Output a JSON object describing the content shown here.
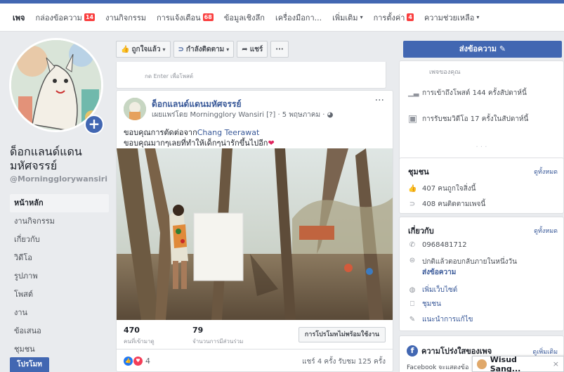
{
  "tabs": [
    {
      "label": "เพจ",
      "active": true
    },
    {
      "label": "กล่องข้อความ",
      "badge": "14"
    },
    {
      "label": "งานกิจกรรม"
    },
    {
      "label": "การแจ้งเตือน",
      "badge": "68"
    },
    {
      "label": "ข้อมูลเชิงลึก"
    },
    {
      "label": "เครื่องมือกา..."
    },
    {
      "label": "เพิ่มเติม",
      "caret": "▾"
    },
    {
      "label": "การตั้งค่า",
      "badge": "4"
    },
    {
      "label": "ความช่วยเหลือ",
      "caret": "▾"
    }
  ],
  "page": {
    "name": "ด็อกแลนด์แดนมหัศจรรย์",
    "handle": "@Morningglorywansiri",
    "nav": [
      "หน้าหลัก",
      "งานกิจกรรม",
      "เกี่ยวกับ",
      "วิดีโอ",
      "รูปภาพ",
      "โพสต์",
      "งาน",
      "ข้อเสนอ",
      "ชุมชน"
    ],
    "promote": "โปรโมท"
  },
  "actions": {
    "liked": "ถูกใจแล้ว",
    "following": "กำลังติดตาม",
    "share": "แชร์",
    "more": "···"
  },
  "composer": {
    "hint": "กด Enter เพื่อโพสต์"
  },
  "post": {
    "author": "ด็อกแลนด์แดนมหัศจรรย์",
    "meta": "เผยแพร่โดย Morningglory Wansiri [?] · 5 พฤษภาคม · ",
    "text1_prefix": "ขอบคุณการตัดต่อจาก",
    "text1_link": "Chang Teerawat",
    "text2": "ขอบคุณมากๆเลยที่ทำให้เด็กๆน่ารักขึ้นไปอีก",
    "reach": "470",
    "reach_label": "คนที่เข้ามาดู",
    "engagement": "79",
    "engagement_label": "จำนวนการมีส่วนร่วม",
    "boost": "การโปรโมทไม่พร้อมใช้งาน",
    "reactions_count": "4",
    "shares_text": "แชร์ 4 ครั้ง รับชม 125 ครั้ง"
  },
  "sidebar": {
    "send_message": "ส่งข้อความ",
    "top_text": "เพจของคุณ",
    "reach_week": "การเข้าถึงโพสต์ 144 ครั้งสัปดาห์นี้",
    "video_views": "การรับชมวิดีโอ 17 ครั้งในสัปดาห์นี้",
    "dots": "· · ·",
    "community": {
      "title": "ชุมชน",
      "see_all": "ดูทั้งหมด",
      "likes": "407 คนถูกใจสิ่งนี้",
      "follows": "408 คนติดตามเพจนี้"
    },
    "about": {
      "title": "เกี่ยวกับ",
      "see_all": "ดูทั้งหมด",
      "phone": "0968481712",
      "response": "ปกติแล้วตอบกลับภายในหนึ่งวัน",
      "send": "ส่งข้อความ",
      "website": "เพิ่มเว็บไซต์",
      "category": "ชุมชน",
      "suggest": "แนะนำการแก้ไข"
    },
    "transparency": {
      "title": "ความโปร่งใสของเพจ",
      "more": "ดูเพิ่มเติม",
      "text": "Facebook จะแสดงข้อ"
    }
  },
  "chat": {
    "name": "Wisud Sang...",
    "close": "×"
  }
}
